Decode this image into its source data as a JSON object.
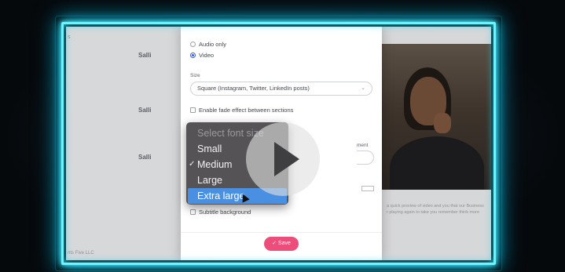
{
  "background_app": {
    "edge_text": "s",
    "footer_text": "nts Five LLC",
    "speakers": [
      "Salli",
      "Salli",
      "Salli"
    ],
    "fragments": [
      "1",
      "1",
      "F",
      "V",
      "\\",
      "\\"
    ],
    "caption_lines": [
      "a quick preview of video and you that our Business",
      "r playing again to take you remember think more"
    ]
  },
  "modal": {
    "audio_only_label": "Audio only",
    "video_label": "Video",
    "size_label": "Size",
    "size_value": "Square (Instagram, Twitter, LinkedIn posts)",
    "fade_label": "Enable fade effect between sections",
    "alignment_fragment": "ment",
    "subtitle_bg_label": "Subtitle background",
    "save_label": "Save"
  },
  "font_size_menu": {
    "header": "Select font size",
    "items": [
      "Small",
      "Medium",
      "Large",
      "Extra large"
    ],
    "checked": "Medium",
    "highlighted": "Extra large"
  },
  "icons": {
    "play": "play-icon",
    "check": "checkmark-icon",
    "cursor": "mouse-pointer-icon"
  },
  "colors": {
    "frame_glow": "#22d3ee",
    "save_button": "#ec4d7a",
    "menu_highlight": "#4a90e2",
    "radio_active": "#3b5bdb"
  }
}
